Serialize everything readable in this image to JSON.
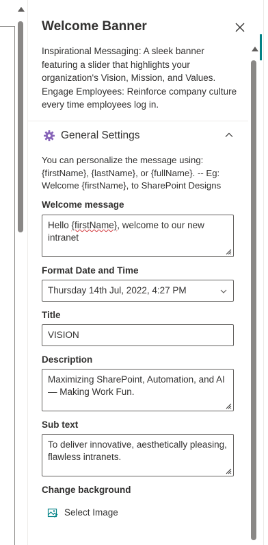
{
  "panel": {
    "title": "Welcome Banner",
    "intro": "Inspirational Messaging: A sleek banner featuring a slider that highlights your organization's Vision, Mission, and Values. Engage Employees: Reinforce company culture every time employees log in.",
    "close_icon": "close-icon"
  },
  "section": {
    "label": "General Settings",
    "icon": "gear-icon",
    "expanded": true,
    "help": "You can personalize the message using: {firstName}, {lastName}, or {fullName}. -- Eg: Welcome {firstName}, to SharePoint Designs"
  },
  "fields": {
    "welcome_message": {
      "label": "Welcome message",
      "value_before": "Hello ",
      "value_spell": "{firstName}",
      "value_after": ", welcome to our new intranet"
    },
    "format_date": {
      "label": "Format Date and Time",
      "selected": "Thursday 14th Jul, 2022, 4:27 PM"
    },
    "title": {
      "label": "Title",
      "value": "VISION"
    },
    "description": {
      "label": "Description",
      "value": "Maximizing SharePoint, Automation, and AI — Making Work Fun."
    },
    "sub_text": {
      "label": "Sub text",
      "value": "To deliver innovative, aesthetically pleasing, flawless intranets."
    },
    "background": {
      "label": "Change background",
      "button": "Select Image",
      "icon": "image-icon"
    }
  },
  "colors": {
    "accent": "#038387",
    "border": "#605e5c",
    "text": "#323130",
    "spellcheck": "#d13438"
  }
}
